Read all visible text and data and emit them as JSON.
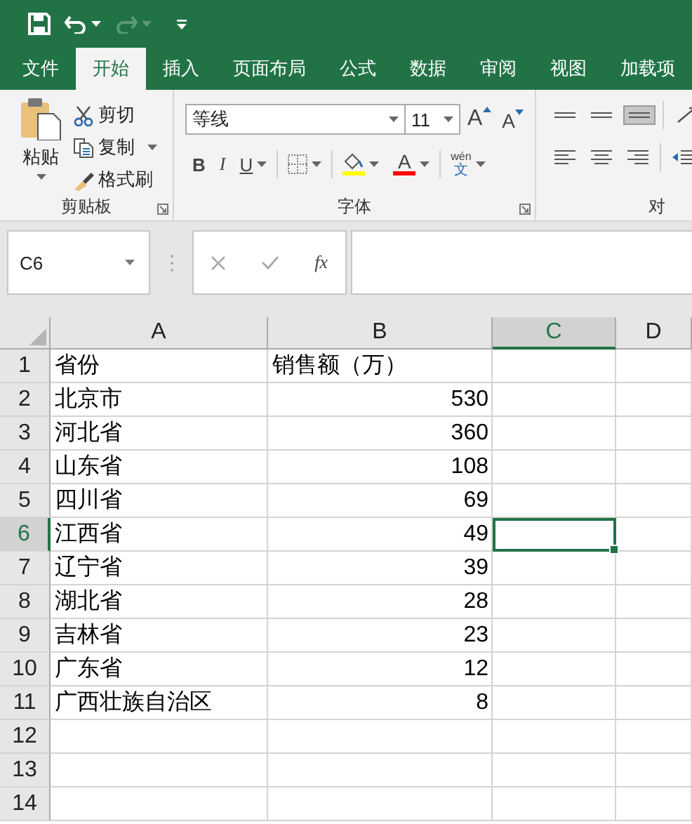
{
  "quick_access": [
    {
      "kind": "save",
      "disabled": false
    },
    {
      "kind": "undo",
      "disabled": false
    },
    {
      "kind": "redo",
      "disabled": true
    },
    {
      "kind": "customize",
      "disabled": false
    }
  ],
  "tabs": [
    {
      "label": "文件",
      "selected": false
    },
    {
      "label": "开始",
      "selected": true
    },
    {
      "label": "插入",
      "selected": false
    },
    {
      "label": "页面布局",
      "selected": false
    },
    {
      "label": "公式",
      "selected": false
    },
    {
      "label": "数据",
      "selected": false
    },
    {
      "label": "审阅",
      "selected": false
    },
    {
      "label": "视图",
      "selected": false
    },
    {
      "label": "加载项",
      "selected": false
    }
  ],
  "ribbon": {
    "clipboard": {
      "paste": "粘贴",
      "cut": "剪切",
      "copy": "复制",
      "format_painter": "格式刷",
      "label": "剪贴板"
    },
    "font": {
      "font_name": "等线",
      "font_size": "11",
      "grow": "A",
      "shrink": "A",
      "bold": "B",
      "italic": "I",
      "underline": "U",
      "font_color": "A",
      "phonetic": "wén",
      "phonetic_char": "文",
      "label": "字体"
    },
    "alignment": {
      "label": "对"
    }
  },
  "formula_bar": {
    "name_box": "C6",
    "cancel_disabled": true,
    "enter_disabled": true,
    "insert_function": "fx"
  },
  "sheet": {
    "columns": [
      {
        "label": "A",
        "selected": false
      },
      {
        "label": "B",
        "selected": false
      },
      {
        "label": "C",
        "selected": true
      },
      {
        "label": "D",
        "selected": false
      }
    ],
    "rows": [
      {
        "number": "1",
        "selected": false,
        "cells": [
          {
            "kind": "text",
            "text": "省份"
          },
          {
            "kind": "text",
            "text": "销售额（万）"
          }
        ]
      },
      {
        "number": "2",
        "selected": false,
        "cells": [
          {
            "kind": "text",
            "text": "北京市"
          },
          {
            "kind": "number",
            "text": "530"
          }
        ]
      },
      {
        "number": "3",
        "selected": false,
        "cells": [
          {
            "kind": "text",
            "text": "河北省"
          },
          {
            "kind": "number",
            "text": "360"
          }
        ]
      },
      {
        "number": "4",
        "selected": false,
        "cells": [
          {
            "kind": "text",
            "text": "山东省"
          },
          {
            "kind": "number",
            "text": "108"
          }
        ]
      },
      {
        "number": "5",
        "selected": false,
        "cells": [
          {
            "kind": "text",
            "text": "四川省"
          },
          {
            "kind": "number",
            "text": "69"
          }
        ]
      },
      {
        "number": "6",
        "selected": true,
        "cells": [
          {
            "kind": "text",
            "text": "江西省"
          },
          {
            "kind": "number",
            "text": "49"
          }
        ]
      },
      {
        "number": "7",
        "selected": false,
        "cells": [
          {
            "kind": "text",
            "text": "辽宁省"
          },
          {
            "kind": "number",
            "text": "39"
          }
        ]
      },
      {
        "number": "8",
        "selected": false,
        "cells": [
          {
            "kind": "text",
            "text": "湖北省"
          },
          {
            "kind": "number",
            "text": "28"
          }
        ]
      },
      {
        "number": "9",
        "selected": false,
        "cells": [
          {
            "kind": "text",
            "text": "吉林省"
          },
          {
            "kind": "number",
            "text": "23"
          }
        ]
      },
      {
        "number": "10",
        "selected": false,
        "cells": [
          {
            "kind": "text",
            "text": "广东省"
          },
          {
            "kind": "number",
            "text": "12"
          }
        ]
      },
      {
        "number": "11",
        "selected": false,
        "cells": [
          {
            "kind": "text",
            "text": "广西壮族自治区"
          },
          {
            "kind": "number",
            "text": "8"
          }
        ]
      },
      {
        "number": "12",
        "selected": false
      },
      {
        "number": "13",
        "selected": false
      },
      {
        "number": "14",
        "selected": false
      }
    ]
  }
}
